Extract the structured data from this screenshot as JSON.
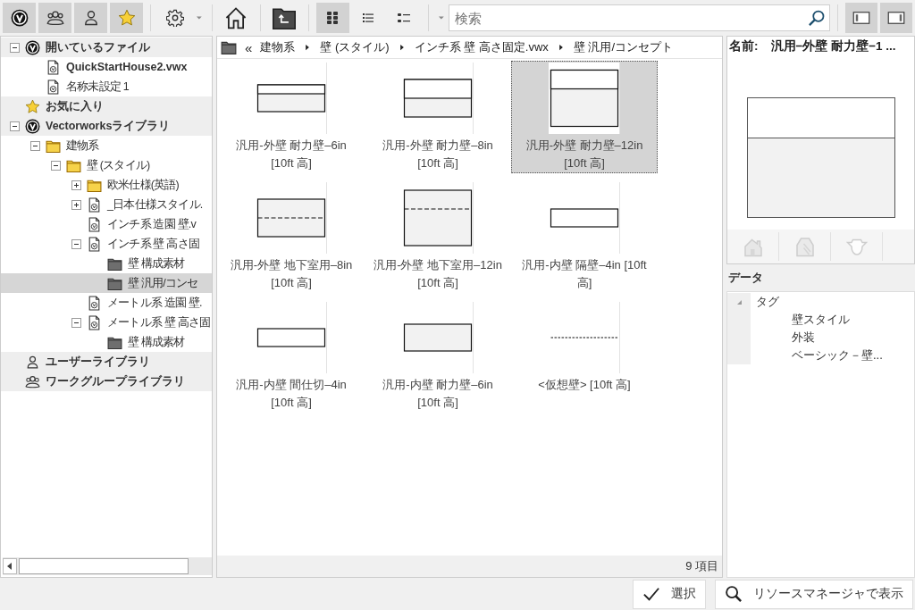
{
  "toolbar": {
    "filters": [
      {
        "kind": "logo",
        "on": true
      },
      {
        "kind": "group",
        "on": true
      },
      {
        "kind": "user",
        "on": true
      },
      {
        "kind": "star",
        "on": true
      }
    ],
    "view_modes": [
      {
        "kind": "grid",
        "selected": true
      },
      {
        "kind": "list",
        "selected": false
      },
      {
        "kind": "details",
        "selected": false
      }
    ],
    "search": {
      "placeholder": "検索"
    },
    "panes": [
      {
        "on": true
      },
      {
        "on": true
      }
    ]
  },
  "tree": [
    {
      "label": "開いているファイル",
      "kind": "logo",
      "expanded": true,
      "selected": false,
      "children": [
        {
          "label": "QuickStartHouse2.vwx",
          "kind": "file",
          "bold": true,
          "selected": false
        },
        {
          "label": "名称未設定 1",
          "kind": "file",
          "bold": false,
          "selected": false
        }
      ]
    },
    {
      "label": "お気に入り",
      "kind": "star",
      "selected": false
    },
    {
      "label": "Vectorworksライブラリ",
      "kind": "logo",
      "expanded": true,
      "selected": false,
      "children": [
        {
          "label": "建物系",
          "kind": "folder",
          "expanded": true,
          "selected": false,
          "children": [
            {
              "label": "壁 (スタイル)",
              "kind": "folder",
              "expanded": true,
              "selected": false,
              "children": [
                {
                  "label": "欧米仕様(英語)",
                  "kind": "folder",
                  "expanded": false,
                  "selected": false
                },
                {
                  "label": "_日本仕様スタイル.",
                  "kind": "file",
                  "expanded": false,
                  "selected": false
                },
                {
                  "label": "インチ系 造園 壁.v",
                  "kind": "file",
                  "selected": false
                },
                {
                  "label": "インチ系 壁 高さ固",
                  "kind": "file",
                  "expanded": true,
                  "selected": false,
                  "children": [
                    {
                      "label": "壁 構成素材",
                      "kind": "darkfolder",
                      "selected": false
                    },
                    {
                      "label": "壁 汎用/コンセ",
                      "kind": "darkfolder",
                      "selected": true
                    }
                  ]
                },
                {
                  "label": "メートル系 造園 壁.",
                  "kind": "file",
                  "selected": false
                },
                {
                  "label": "メートル系 壁 高さ固",
                  "kind": "file",
                  "expanded": true,
                  "selected": false,
                  "children": [
                    {
                      "label": "壁 構成素材",
                      "kind": "darkfolder",
                      "selected": false
                    }
                  ]
                }
              ]
            }
          ]
        }
      ]
    },
    {
      "label": "ユーザーライブラリ",
      "kind": "user",
      "selected": false
    },
    {
      "label": "ワークグループライブラリ",
      "kind": "group",
      "selected": false
    }
  ],
  "breadcrumb": {
    "overflow": "«",
    "items": [
      "建物系",
      "壁 (スタイル)",
      "インチ系 壁 高さ固定.vwx",
      "壁 汎用/コンセプト"
    ]
  },
  "items": [
    {
      "label": "汎用-外壁 耐力壁–6in [10ft 高]",
      "selected": false,
      "kind": "thinwall"
    },
    {
      "label": "汎用-外壁 耐力壁–8in [10ft 高]",
      "selected": false,
      "kind": "midwall"
    },
    {
      "label": "汎用-外壁 耐力壁–12in [10ft 高]",
      "selected": true,
      "kind": "thickwall"
    },
    {
      "label": "汎用-外壁 地下室用–8in [10ft 高]",
      "selected": false,
      "kind": "dashedmid"
    },
    {
      "label": "汎用-外壁 地下室用–12in [10ft 高]",
      "selected": false,
      "kind": "dashedthick"
    },
    {
      "label": "汎用-内壁 隔壁–4in [10ft 高]",
      "selected": false,
      "kind": "partition"
    },
    {
      "label": "汎用-内壁 間仕切–4in [10ft 高]",
      "selected": false,
      "kind": "partition"
    },
    {
      "label": "汎用-内壁 耐力壁–6in [10ft 高]",
      "selected": false,
      "kind": "solidwall"
    },
    {
      "label": "<仮想壁> [10ft 高]",
      "selected": false,
      "kind": "centerline"
    }
  ],
  "status": "9 項目",
  "details": {
    "name_label": "名前:",
    "name": "汎用−外壁 耐力壁−1 ...",
    "kind": "thickwall",
    "tools": [
      {
        "kind": "house",
        "disabled": true
      },
      {
        "kind": "solid",
        "disabled": true
      },
      {
        "kind": "teapot",
        "disabled": true
      }
    ]
  },
  "data": {
    "title": "データ",
    "tree": [
      {
        "label": "タグ",
        "expanded": true,
        "children": [
          {
            "label": "壁スタイル"
          },
          {
            "label": "外装"
          },
          {
            "label": "ベーシック－壁..."
          }
        ]
      }
    ]
  },
  "actions": [
    {
      "kind": "check",
      "label": "選択"
    },
    {
      "kind": "search",
      "label": "リソースマネージャで表示"
    }
  ]
}
